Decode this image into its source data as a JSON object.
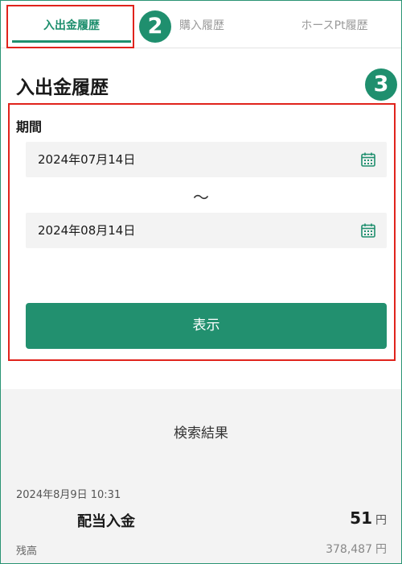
{
  "tabs": [
    {
      "label": "入出金履歴",
      "active": true
    },
    {
      "label": "購入履歴",
      "active": false
    },
    {
      "label": "ホースPt履歴",
      "active": false
    }
  ],
  "badges": {
    "tabs": "2",
    "form": "3"
  },
  "page_title": "入出金履歴",
  "period": {
    "label": "期間",
    "start_date": "2024年07月14日",
    "separator": "～",
    "end_date": "2024年08月14日"
  },
  "show_button": "表示",
  "results": {
    "title": "検索結果",
    "items": [
      {
        "datetime": "2024年8月9日 10:31",
        "type": "配当入金",
        "amount": "51",
        "amount_unit": "円",
        "balance_label": "残高",
        "balance": "378,487",
        "balance_unit": "円"
      }
    ]
  },
  "colors": {
    "accent": "#1f8f6e",
    "highlight": "#e0231c",
    "field_bg": "#f3f3f3"
  }
}
